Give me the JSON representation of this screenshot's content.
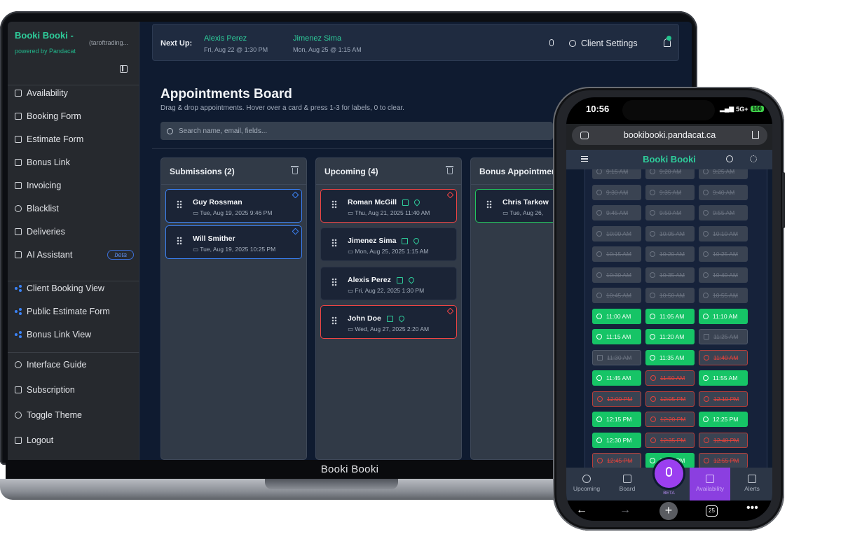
{
  "laptop": {
    "footer_label": "Booki Booki",
    "sidebar": {
      "brand": "Booki Booki -",
      "brand_sub": "powered by Pandacat",
      "account": "(taroftrading...",
      "items": [
        {
          "label": "Availability",
          "icon": "calendar-icon"
        },
        {
          "label": "Booking Form",
          "icon": "file-icon"
        },
        {
          "label": "Estimate Form",
          "icon": "clipboard-icon"
        },
        {
          "label": "Bonus Link",
          "icon": "gift-icon"
        },
        {
          "label": "Invoicing",
          "icon": "receipt-icon"
        },
        {
          "label": "Blacklist",
          "icon": "ban-icon"
        },
        {
          "label": "Deliveries",
          "icon": "truck-icon"
        },
        {
          "label": "AI Assistant",
          "icon": "bot-icon",
          "badge": "beta"
        },
        {
          "label": "Client Booking View",
          "icon": "share-icon"
        },
        {
          "label": "Public Estimate Form",
          "icon": "share-icon"
        },
        {
          "label": "Bonus Link View",
          "icon": "share-icon"
        },
        {
          "label": "Interface Guide",
          "icon": "help-icon"
        },
        {
          "label": "Subscription",
          "icon": "card-icon"
        },
        {
          "label": "Toggle Theme",
          "icon": "moon-icon"
        },
        {
          "label": "Logout",
          "icon": "logout-icon"
        }
      ]
    },
    "header": {
      "next_up_label": "Next Up:",
      "next_up": [
        {
          "name": "Alexis Perez",
          "time": "Fri, Aug 22 @ 1:30 PM"
        },
        {
          "name": "Jimenez Sima",
          "time": "Mon, Aug 25 @ 1:15 AM"
        }
      ],
      "client_settings": "Client Settings"
    },
    "board": {
      "title": "Appointments Board",
      "subtitle": "Drag & drop appointments. Hover over a card & press 1-3 for labels, 0 to clear.",
      "search_placeholder": "Search name, email, fields...",
      "columns": [
        {
          "title": "Submissions (2)",
          "cards": [
            {
              "name": "Guy Rossman",
              "time": "Tue, Aug 19, 2025 9:46 PM"
            },
            {
              "name": "Will Smither",
              "time": "Tue, Aug 19, 2025 10:25 PM"
            }
          ]
        },
        {
          "title": "Upcoming (4)",
          "cards": [
            {
              "name": "Roman McGill",
              "time": "Thu, Aug 21, 2025 11:40 AM"
            },
            {
              "name": "Jimenez Sima",
              "time": "Mon, Aug 25, 2025 1:15 AM"
            },
            {
              "name": "Alexis Perez",
              "time": "Fri, Aug 22, 2025 1:30 PM"
            },
            {
              "name": "John Doe",
              "time": "Wed, Aug 27, 2025 2:20 AM"
            }
          ]
        },
        {
          "title": "Bonus Appointments",
          "cards": [
            {
              "name": "Chris Tarkow",
              "time": "Tue, Aug 26,"
            }
          ]
        }
      ]
    }
  },
  "phone": {
    "status": {
      "time": "10:56",
      "network": "5G+",
      "battery": "100"
    },
    "url": "bookibooki.pandacat.ca",
    "app_title": "Booki Booki",
    "slots": [
      {
        "time": "9:15 AM",
        "state": "past"
      },
      {
        "time": "9:20 AM",
        "state": "past"
      },
      {
        "time": "9:25 AM",
        "state": "past"
      },
      {
        "time": "9:30 AM",
        "state": "past"
      },
      {
        "time": "9:35 AM",
        "state": "past"
      },
      {
        "time": "9:40 AM",
        "state": "past"
      },
      {
        "time": "9:45 AM",
        "state": "past"
      },
      {
        "time": "9:50 AM",
        "state": "past"
      },
      {
        "time": "9:55 AM",
        "state": "past"
      },
      {
        "time": "10:00 AM",
        "state": "past"
      },
      {
        "time": "10:05 AM",
        "state": "past"
      },
      {
        "time": "10:10 AM",
        "state": "past"
      },
      {
        "time": "10:15 AM",
        "state": "past"
      },
      {
        "time": "10:20 AM",
        "state": "past"
      },
      {
        "time": "10:25 AM",
        "state": "past"
      },
      {
        "time": "10:30 AM",
        "state": "past"
      },
      {
        "time": "10:35 AM",
        "state": "past"
      },
      {
        "time": "10:40 AM",
        "state": "past"
      },
      {
        "time": "10:45 AM",
        "state": "past"
      },
      {
        "time": "10:50 AM",
        "state": "past"
      },
      {
        "time": "10:55 AM",
        "state": "past"
      },
      {
        "time": "11:00 AM",
        "state": "avail"
      },
      {
        "time": "11:05 AM",
        "state": "avail"
      },
      {
        "time": "11:10 AM",
        "state": "avail"
      },
      {
        "time": "11:15 AM",
        "state": "avail"
      },
      {
        "time": "11:20 AM",
        "state": "avail"
      },
      {
        "time": "11:25 AM",
        "state": "booked"
      },
      {
        "time": "11:30 AM",
        "state": "booked"
      },
      {
        "time": "11:35 AM",
        "state": "avail"
      },
      {
        "time": "11:40 AM",
        "state": "blocked"
      },
      {
        "time": "11:45 AM",
        "state": "avail"
      },
      {
        "time": "11:50 AM",
        "state": "blocked"
      },
      {
        "time": "11:55 AM",
        "state": "avail"
      },
      {
        "time": "12:00 PM",
        "state": "blocked"
      },
      {
        "time": "12:05 PM",
        "state": "blocked"
      },
      {
        "time": "12:10 PM",
        "state": "blocked"
      },
      {
        "time": "12:15 PM",
        "state": "avail"
      },
      {
        "time": "12:20 PM",
        "state": "blocked"
      },
      {
        "time": "12:25 PM",
        "state": "avail"
      },
      {
        "time": "12:30 PM",
        "state": "avail"
      },
      {
        "time": "12:35 PM",
        "state": "blocked"
      },
      {
        "time": "12:40 PM",
        "state": "blocked"
      },
      {
        "time": "12:45 PM",
        "state": "blocked"
      },
      {
        "time": "12:50 PM",
        "state": "avail"
      },
      {
        "time": "12:55 PM",
        "state": "blocked"
      }
    ],
    "tabs": [
      {
        "label": "Upcoming",
        "icon": "clock-icon"
      },
      {
        "label": "Board",
        "icon": "briefcase-icon"
      },
      {
        "label": "Availability",
        "icon": "calendar-icon"
      },
      {
        "label": "Alerts",
        "icon": "bell-icon"
      }
    ],
    "fab_label": "BETA",
    "browser_tabs_count": "25"
  }
}
